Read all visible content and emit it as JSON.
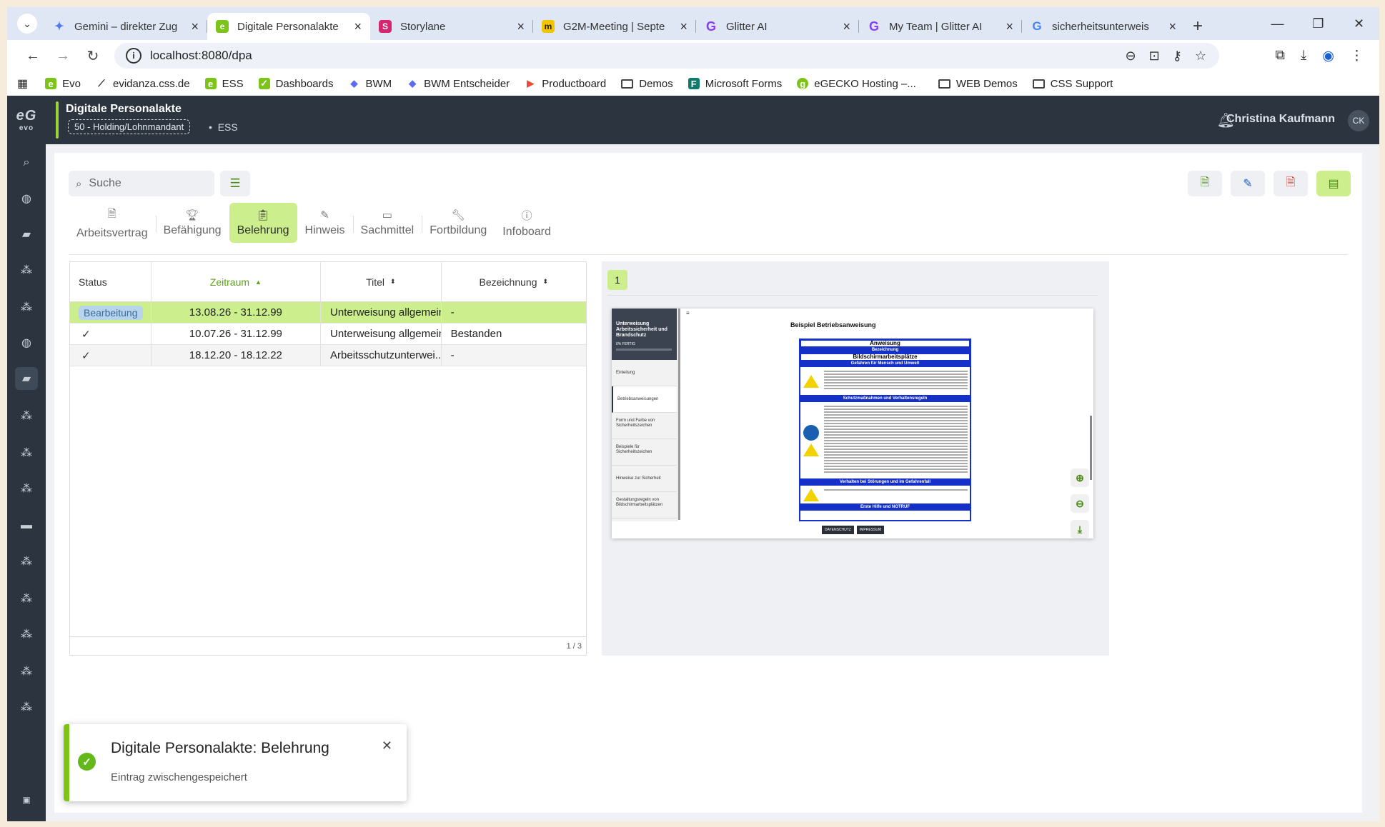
{
  "browser": {
    "tabs": [
      {
        "title": "Gemini – direkter Zug",
        "favicon": "gemini-icon",
        "color": "#4b7bec"
      },
      {
        "title": "Digitale Personalakte",
        "favicon": "evo-icon",
        "color": "#7cc418",
        "active": true
      },
      {
        "title": "Storylane",
        "favicon": "storylane-icon",
        "color": "#d6246e"
      },
      {
        "title": "G2M-Meeting | Septe",
        "favicon": "miro-icon",
        "color": "#f2c500"
      },
      {
        "title": "Glitter AI",
        "favicon": "glitter-icon",
        "color": "#8a3cf0"
      },
      {
        "title": "My Team | Glitter AI",
        "favicon": "glitter-icon",
        "color": "#8a3cf0"
      },
      {
        "title": "sicherheitsunterweis",
        "favicon": "google-icon",
        "color": "#4285f4"
      }
    ],
    "url": "localhost:8080/dpa",
    "bookmarks": [
      {
        "label": "Evo",
        "icon": "evo-icon"
      },
      {
        "label": "evidanza.css.de",
        "icon": "evidanza-icon"
      },
      {
        "label": "ESS",
        "icon": "evo-icon"
      },
      {
        "label": "Dashboards",
        "icon": "dashboards-icon"
      },
      {
        "label": "BWM",
        "icon": "bwm-icon"
      },
      {
        "label": "BWM Entscheider",
        "icon": "bwm-icon"
      },
      {
        "label": "Productboard",
        "icon": "productboard-icon"
      },
      {
        "label": "Demos",
        "icon": "folder-icon"
      },
      {
        "label": "Microsoft Forms",
        "icon": "forms-icon"
      },
      {
        "label": "eGECKO Hosting –...",
        "icon": "egecko-icon"
      },
      {
        "label": "WEB Demos",
        "icon": "folder-icon"
      },
      {
        "label": "CSS Support",
        "icon": "folder-icon"
      }
    ]
  },
  "app": {
    "logo": "evo",
    "title": "Digitale Personalakte",
    "mandant": "50 - Holding/Lohnmandant",
    "context": "ESS",
    "user": "Christina Kaufmann",
    "initials": "CK",
    "accent": "#9ad13a"
  },
  "search": {
    "placeholder": "Suche"
  },
  "tabs": [
    {
      "label": "Arbeitsvertrag",
      "icon": "document-icon"
    },
    {
      "label": "Befähigung",
      "icon": "trophy-icon"
    },
    {
      "label": "Belehrung",
      "icon": "clipboard-icon",
      "active": true
    },
    {
      "label": "Hinweis",
      "icon": "pencil-icon"
    },
    {
      "label": "Sachmittel",
      "icon": "monitor-icon"
    },
    {
      "label": "Fortbildung",
      "icon": "wrench-icon"
    },
    {
      "label": "Infoboard",
      "icon": "info-icon"
    }
  ],
  "table": {
    "headers": {
      "status": "Status",
      "zeitraum": "Zeitraum",
      "titel": "Titel",
      "bezeichnung": "Bezeichnung"
    },
    "rows": [
      {
        "status": "Bearbeitung",
        "zeitraum": "13.08.26 - 31.12.99",
        "titel": "Unterweisung allgemein",
        "bezeichnung": "-"
      },
      {
        "status": "check",
        "zeitraum": "10.07.26 - 31.12.99",
        "titel": "Unterweisung allgemein",
        "bezeichnung": "Bestanden"
      },
      {
        "status": "check",
        "zeitraum": "18.12.20 - 18.12.22",
        "titel": "Arbeitsschutzunterwei...",
        "bezeichnung": "-"
      }
    ],
    "pagination": "1 / 3"
  },
  "preview": {
    "page": "1",
    "nav_title": "Unterweisung Arbeitssicherheit und Brandschutz",
    "progress": "0% FERTIG",
    "nav_items": [
      "Einleitung",
      "Betriebsanweisungen",
      "Form und Farbe von Sicherheitszeichen",
      "Beispiele für Sicherheitszeichen",
      "Hinweise zur Sicherheit",
      "Gestaltungsregeln von Bildschirmarbeitsplätzen"
    ],
    "doc_title": "Beispiel Betriebsanweisung",
    "poster": {
      "heading": "Anweisung",
      "sub": "Bezeichnung",
      "title": "Bildschirmarbeitsplätze",
      "sections": [
        "Gefahren für Mensch und Umwelt",
        "Schutzmaßnahmen und Verhaltensregeln",
        "Verhalten bei Störungen und im Gefahrenfall",
        "Erste Hilfe und NOTRUF"
      ]
    },
    "buttons": [
      "DATENSCHUTZ",
      "IMPRESSUM"
    ]
  },
  "toast": {
    "title": "Digitale Personalakte: Belehrung",
    "message": "Eintrag zwischengespeichert"
  }
}
